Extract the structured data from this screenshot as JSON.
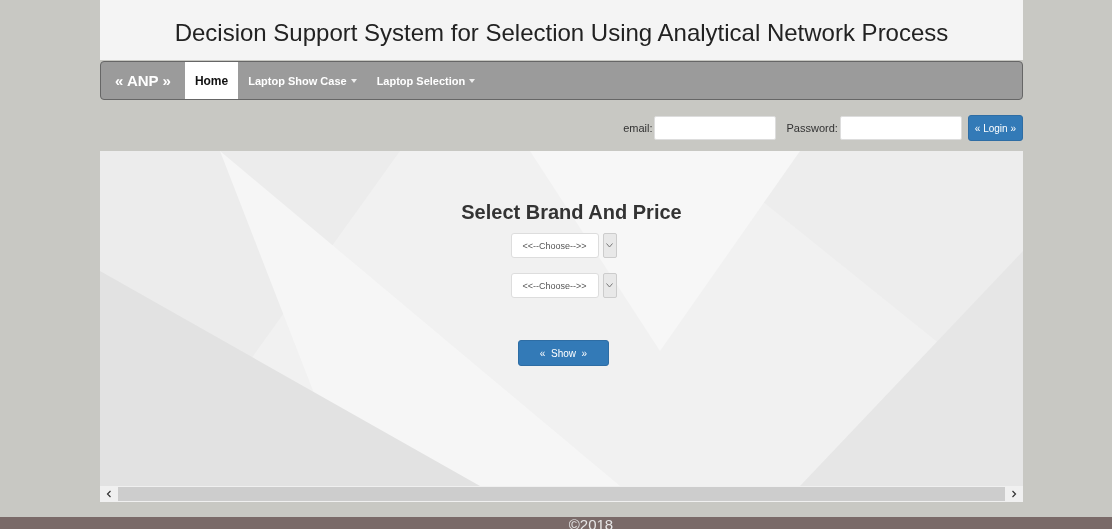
{
  "header": {
    "title": "Decision Support System for Selection Using Analytical Network Process"
  },
  "nav": {
    "brand": "« ANP »",
    "items": [
      {
        "label": "Home",
        "selected": true,
        "dropdown": false
      },
      {
        "label": "Laptop Show Case",
        "selected": false,
        "dropdown": true
      },
      {
        "label": "Laptop Selection",
        "selected": false,
        "dropdown": true
      }
    ]
  },
  "login": {
    "fields": [
      {
        "label": "email:"
      },
      {
        "label": "Password:"
      }
    ],
    "button": "« Login »"
  },
  "main": {
    "title": "Select Brand And Price",
    "selects": [
      {
        "value": "<<--Choose-->>"
      },
      {
        "value": "<<--Choose-->>"
      }
    ],
    "button": "«  Show  »"
  },
  "footer": {
    "text": "©2018"
  }
}
